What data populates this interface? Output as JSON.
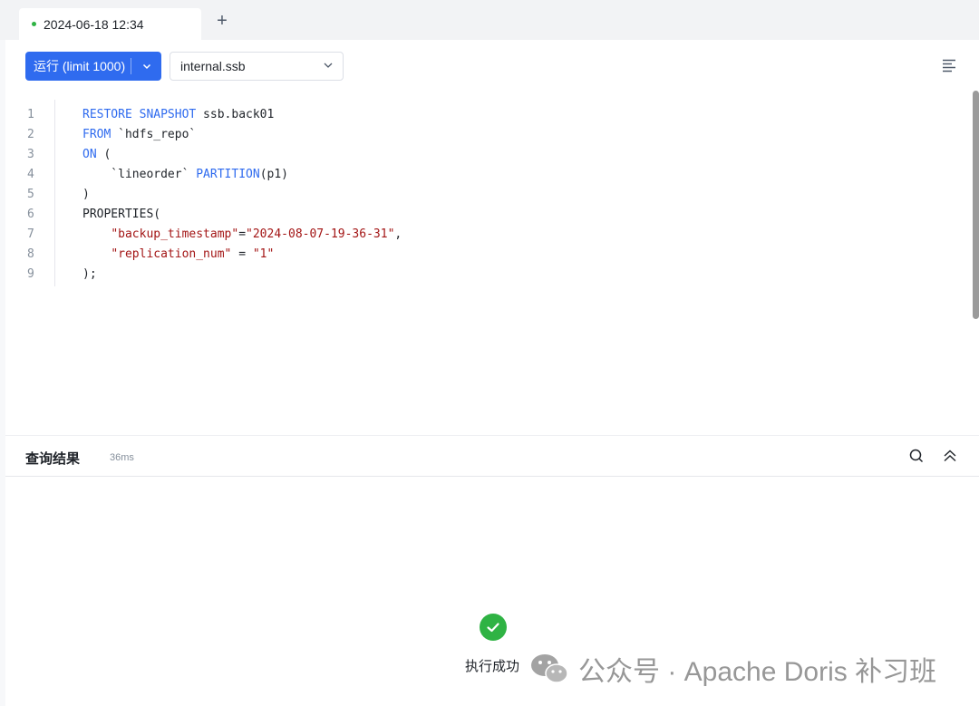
{
  "tabbar": {
    "tab_title": "2024-06-18 12:34",
    "add_label": "+"
  },
  "toolbar": {
    "run_label": "运行 (limit 1000)",
    "database": "internal.ssb"
  },
  "editor": {
    "line_numbers": [
      "1",
      "2",
      "3",
      "4",
      "5",
      "6",
      "7",
      "8",
      "9"
    ]
  },
  "results": {
    "title": "查询结果",
    "duration": "36ms",
    "status": "执行成功"
  },
  "watermark": {
    "text": "公众号 · Apache Doris 补习班"
  },
  "colors": {
    "accent": "#2f6bef",
    "success": "#2fb344",
    "keyword": "#2f6bef",
    "string": "#a31515"
  }
}
